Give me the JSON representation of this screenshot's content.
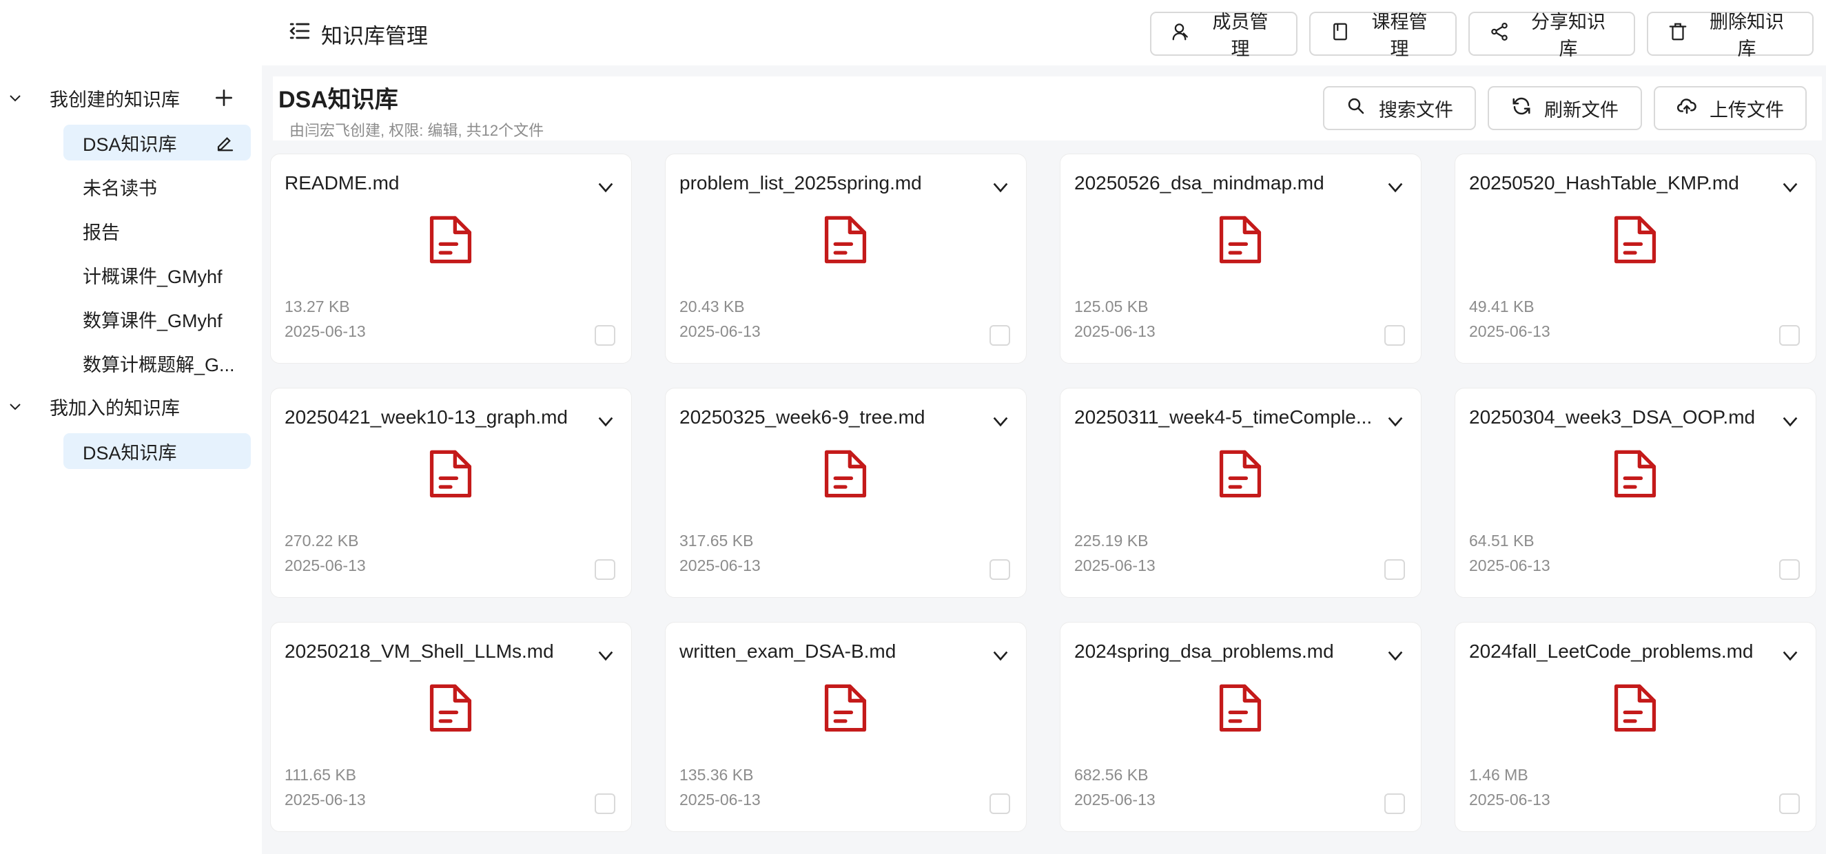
{
  "header": {
    "title": "知识库管理",
    "actions": [
      {
        "label": "成员管理",
        "icon": "user-icon"
      },
      {
        "label": "课程管理",
        "icon": "book-icon"
      },
      {
        "label": "分享知识库",
        "icon": "share-icon"
      },
      {
        "label": "删除知识库",
        "icon": "trash-icon"
      }
    ]
  },
  "sidebar": {
    "created_group": {
      "label": "我创建的知识库",
      "items": [
        "DSA知识库",
        "未名读书",
        "报告",
        "计概课件_GMyhf",
        "数算课件_GMyhf",
        "数算计概题解_G..."
      ]
    },
    "joined_group": {
      "label": "我加入的知识库",
      "items": [
        "DSA知识库"
      ]
    }
  },
  "kb": {
    "title": "DSA知识库",
    "subtitle": "由闫宏飞创建, 权限: 编辑, 共12个文件",
    "actions": [
      {
        "label": "搜索文件",
        "icon": "search-icon"
      },
      {
        "label": "刷新文件",
        "icon": "refresh-icon"
      },
      {
        "label": "上传文件",
        "icon": "upload-icon"
      }
    ]
  },
  "files": [
    {
      "name": "README.md",
      "size": "13.27 KB",
      "date": "2025-06-13"
    },
    {
      "name": "problem_list_2025spring.md",
      "size": "20.43 KB",
      "date": "2025-06-13"
    },
    {
      "name": "20250526_dsa_mindmap.md",
      "size": "125.05 KB",
      "date": "2025-06-13"
    },
    {
      "name": "20250520_HashTable_KMP.md",
      "size": "49.41 KB",
      "date": "2025-06-13"
    },
    {
      "name": "20250421_week10-13_graph.md",
      "size": "270.22 KB",
      "date": "2025-06-13"
    },
    {
      "name": "20250325_week6-9_tree.md",
      "size": "317.65 KB",
      "date": "2025-06-13"
    },
    {
      "name": "20250311_week4-5_timeComple...",
      "size": "225.19 KB",
      "date": "2025-06-13"
    },
    {
      "name": "20250304_week3_DSA_OOP.md",
      "size": "64.51 KB",
      "date": "2025-06-13"
    },
    {
      "name": "20250218_VM_Shell_LLMs.md",
      "size": "111.65 KB",
      "date": "2025-06-13"
    },
    {
      "name": "written_exam_DSA-B.md",
      "size": "135.36 KB",
      "date": "2025-06-13"
    },
    {
      "name": "2024spring_dsa_problems.md",
      "size": "682.56 KB",
      "date": "2025-06-13"
    },
    {
      "name": "2024fall_LeetCode_problems.md",
      "size": "1.46 MB",
      "date": "2025-06-13"
    }
  ],
  "colors": {
    "accent_bg": "#e6f2fd",
    "file_icon": "#c41a1a"
  }
}
